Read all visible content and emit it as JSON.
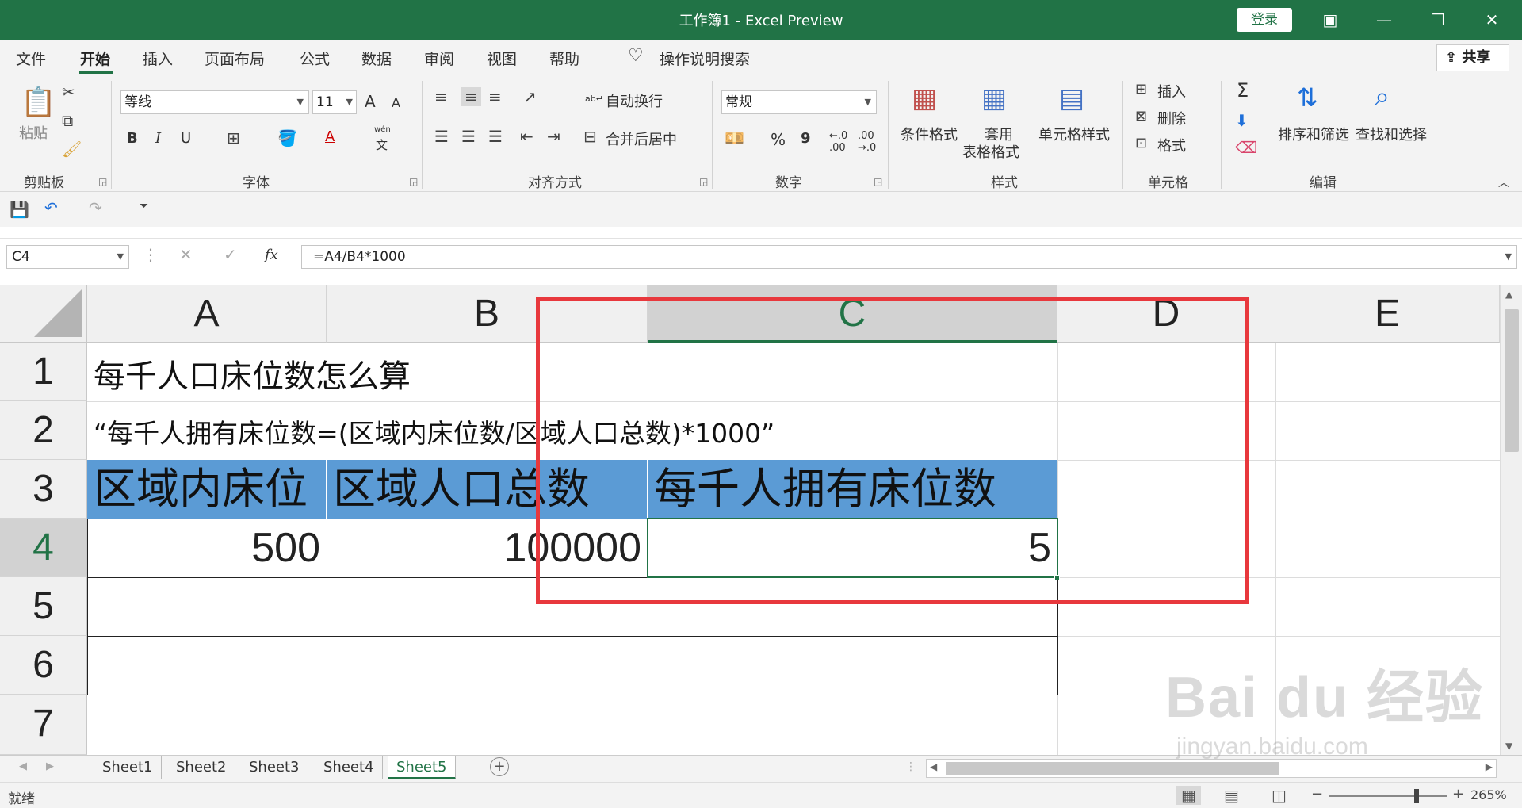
{
  "window": {
    "title": "工作簿1  -  Excel Preview",
    "login": "登录",
    "icons": [
      "restore-icon",
      "minimize-icon",
      "maximize-icon",
      "close-icon"
    ]
  },
  "menu": {
    "tabs": [
      "文件",
      "开始",
      "插入",
      "页面布局",
      "公式",
      "数据",
      "审阅",
      "视图",
      "帮助"
    ],
    "active_tab": "开始",
    "tell_me": "操作说明搜索",
    "share": "共享"
  },
  "ribbon": {
    "clipboard": {
      "label": "剪贴板",
      "paste": "粘贴"
    },
    "font": {
      "label": "字体",
      "name": "等线",
      "size": "11",
      "bold": "B",
      "italic": "I",
      "underline": "U",
      "grow": "A",
      "shrink": "A",
      "color_a": "A",
      "phonetic_top": "wén",
      "phonetic_bottom": "文"
    },
    "alignment": {
      "label": "对齐方式",
      "wrap": "自动换行",
      "merge": "合并后居中"
    },
    "number": {
      "label": "数字",
      "format": "常规",
      "percent": "%",
      "comma": "9",
      "inc_decimal": "←.0\n.00",
      "dec_decimal": ".00\n→.0"
    },
    "styles": {
      "label": "样式",
      "conditional": "条件格式",
      "table_top": "套用",
      "table_bottom": "表格格式",
      "cell_styles": "单元格样式"
    },
    "cells": {
      "label": "单元格",
      "insert": "插入",
      "delete": "删除",
      "format": "格式"
    },
    "editing": {
      "label": "编辑",
      "sort": "排序和筛选",
      "find": "查找和选择",
      "sum": "Σ"
    }
  },
  "formula_bar": {
    "name_box": "C4",
    "fx": "fx",
    "formula": "=A4/B4*1000"
  },
  "grid": {
    "columns": [
      "A",
      "B",
      "C",
      "D",
      "E"
    ],
    "selected_column": "C",
    "rows": [
      "1",
      "2",
      "3",
      "4",
      "5",
      "6",
      "7"
    ],
    "selected_row": "4",
    "cells": {
      "A1": "每千人口床位数怎么算",
      "A2": "“每千人拥有床位数=(区域内床位数/区域人口总数)*1000”",
      "A3": "区域内床位",
      "B3": "区域人口总数",
      "C3": "每千人拥有床位数",
      "A4": "500",
      "B4": "100000",
      "C4": "5"
    },
    "header_fill": "#5b9bd5",
    "highlight_color": "#e8383d"
  },
  "sheets": {
    "tabs": [
      "Sheet1",
      "Sheet2",
      "Sheet3",
      "Sheet4",
      "Sheet5"
    ],
    "active": "Sheet5"
  },
  "status": {
    "ready": "就绪",
    "zoom": "265%"
  },
  "watermark": {
    "brand": "Bai du 经验",
    "url": "jingyan.baidu.com"
  }
}
